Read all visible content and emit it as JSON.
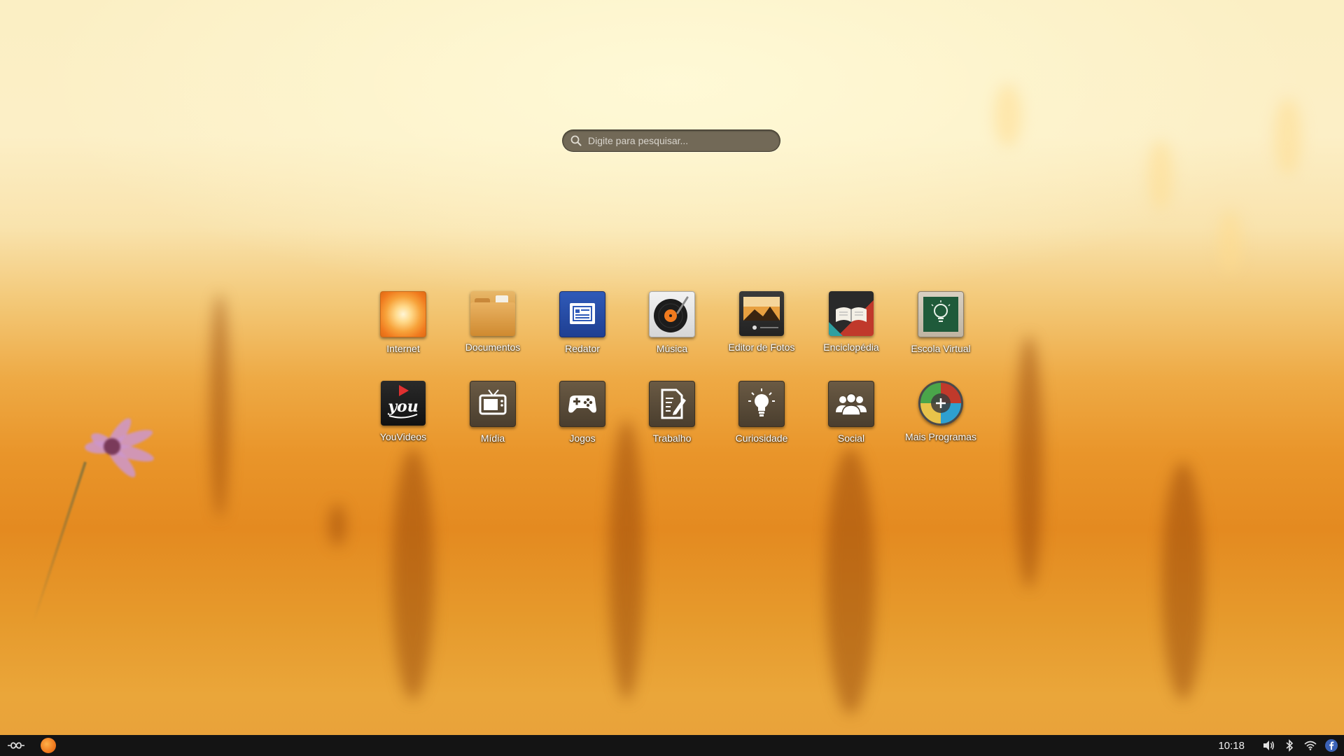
{
  "search": {
    "placeholder": "Digite para pesquisar..."
  },
  "apps": [
    {
      "label": "Internet",
      "icon": "internet-icon"
    },
    {
      "label": "Documentos",
      "icon": "folder-icon"
    },
    {
      "label": "Redator",
      "icon": "text-editor-icon"
    },
    {
      "label": "Música",
      "icon": "record-player-icon"
    },
    {
      "label": "Editor de Fotos",
      "icon": "photo-editor-icon"
    },
    {
      "label": "Enciclopédia",
      "icon": "open-book-icon"
    },
    {
      "label": "Escola Virtual",
      "icon": "chalkboard-lightbulb-icon"
    },
    {
      "label": "YouVideos",
      "icon": "video-play-icon"
    },
    {
      "label": "Mídia",
      "icon": "tv-icon"
    },
    {
      "label": "Jogos",
      "icon": "gamepad-icon"
    },
    {
      "label": "Trabalho",
      "icon": "document-pen-icon"
    },
    {
      "label": "Curiosidade",
      "icon": "lightbulb-icon"
    },
    {
      "label": "Social",
      "icon": "people-icon"
    },
    {
      "label": "Mais Programas",
      "icon": "add-programs-icon"
    }
  ],
  "youvideos_icon_text": "you",
  "taskbar": {
    "clock": "10:18",
    "tray": [
      "volume-icon",
      "bluetooth-icon",
      "wifi-icon",
      "facebook-icon"
    ]
  },
  "colors": {
    "taskbar_bg": "#141414",
    "search_bg": "#5f5546",
    "label_color": "#ffffff",
    "internet_orange": "#f07a1e",
    "redator_blue": "#2f5ab8"
  }
}
